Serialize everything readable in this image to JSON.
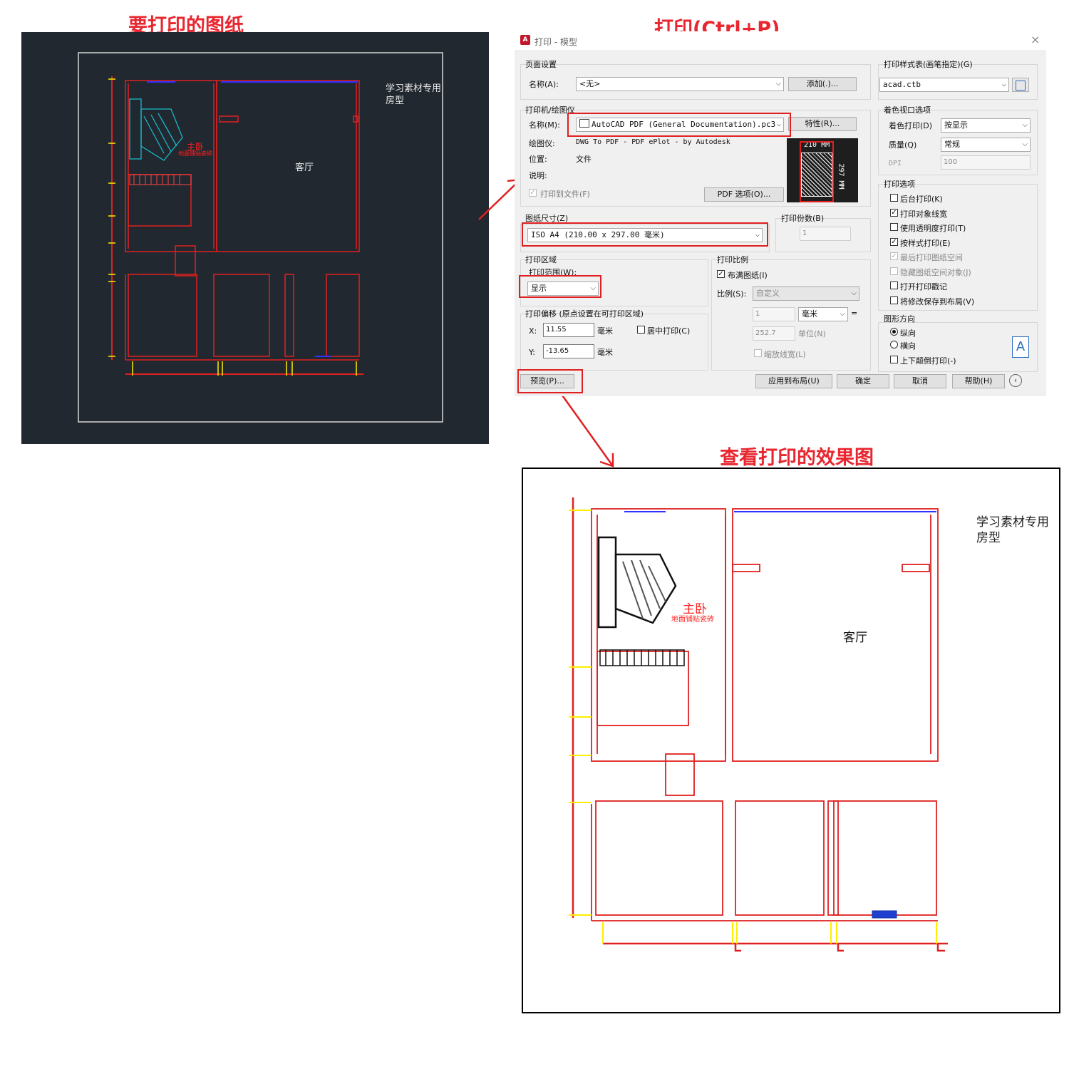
{
  "headings": {
    "drawing": "要打印的图纸",
    "print": "打印(Ctrl+P)",
    "preview": "查看打印的效果图"
  },
  "drawing": {
    "annotation": [
      "学习素材专用",
      "房型"
    ],
    "room_living": "客厅",
    "room_master": "主卧",
    "room_master_sub": "地面铺贴瓷砖"
  },
  "dialog": {
    "title": "打印 - 模型",
    "page_setup": {
      "group": "页面设置",
      "name_label": "名称(A):",
      "name_value": "<无>",
      "add_button": "添加(.)..."
    },
    "printer": {
      "group": "打印机/绘图仪",
      "name_label": "名称(M):",
      "name_value": "AutoCAD PDF (General Documentation).pc3",
      "properties_button": "特性(R)...",
      "plotter_label": "绘图仪:",
      "plotter_value": "DWG To PDF - PDF ePlot - by Autodesk",
      "location_label": "位置:",
      "location_value": "文件",
      "description_label": "说明:",
      "print_to_file": "打印到文件(F)",
      "pdf_options_button": "PDF 选项(O)...",
      "paper_width": "210 MM",
      "paper_height": "297 MM"
    },
    "paper_size": {
      "group": "图纸尺寸(Z)",
      "value": "ISO A4 (210.00 x 297.00 毫米)"
    },
    "copies": {
      "group": "打印份数(B)",
      "value": "1"
    },
    "plot_area": {
      "group": "打印区域",
      "range_label": "打印范围(W):",
      "range_value": "显示"
    },
    "plot_offset": {
      "group": "打印偏移 (原点设置在可打印区域)",
      "x_label": "X:",
      "x_value": "11.55",
      "x_unit": "毫米",
      "y_label": "Y:",
      "y_value": "-13.65",
      "y_unit": "毫米",
      "center": "居中打印(C)"
    },
    "plot_scale": {
      "group": "打印比例",
      "fit": "布满图纸(I)",
      "scale_label": "比例(S):",
      "scale_value": "自定义",
      "v1": "1",
      "unit1": "毫米",
      "equals": "=",
      "v2": "252.7",
      "unit2": "单位(N)",
      "scale_lw": "缩放线宽(L)"
    },
    "style_table": {
      "group": "打印样式表(画笔指定)(G)",
      "value": "acad.ctb"
    },
    "shaded": {
      "group": "着色视口选项",
      "shade_label": "着色打印(D)",
      "shade_value": "按显示",
      "quality_label": "质量(Q)",
      "quality_value": "常规",
      "dpi_label": "DPI",
      "dpi_value": "100"
    },
    "options": {
      "group": "打印选项",
      "items": [
        {
          "label": "后台打印(K)",
          "checked": false,
          "disabled": false
        },
        {
          "label": "打印对象线宽",
          "checked": true,
          "disabled": false
        },
        {
          "label": "使用透明度打印(T)",
          "checked": false,
          "disabled": false
        },
        {
          "label": "按样式打印(E)",
          "checked": true,
          "disabled": false
        },
        {
          "label": "最后打印图纸空间",
          "checked": true,
          "disabled": true
        },
        {
          "label": "隐藏图纸空间对象(J)",
          "checked": false,
          "disabled": true
        },
        {
          "label": "打开打印戳记",
          "checked": false,
          "disabled": false
        },
        {
          "label": "将修改保存到布局(V)",
          "checked": false,
          "disabled": false
        }
      ]
    },
    "orientation": {
      "group": "图形方向",
      "portrait": "纵向",
      "landscape": "横向",
      "upside": "上下颠倒打印(-)"
    },
    "buttons": {
      "preview": "预览(P)...",
      "apply": "应用到布局(U)",
      "ok": "确定",
      "cancel": "取消",
      "help": "帮助(H)"
    }
  }
}
